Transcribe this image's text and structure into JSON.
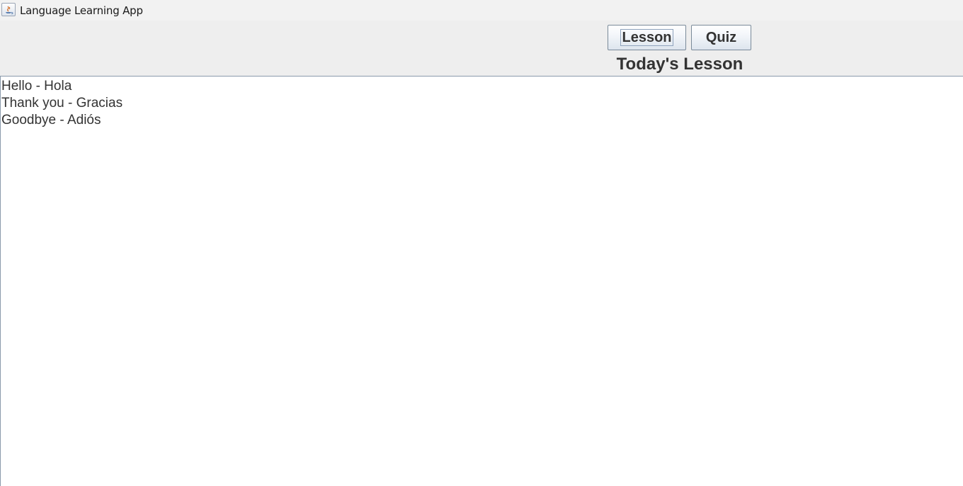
{
  "window": {
    "title": "Language Learning App",
    "icon": "java-icon"
  },
  "toolbar": {
    "lesson_label": "Lesson",
    "quiz_label": "Quiz",
    "selected": "Lesson"
  },
  "lesson": {
    "heading": "Today's Lesson",
    "lines": [
      "Hello - Hola",
      "Thank you - Gracias",
      "Goodbye - Adiós"
    ]
  }
}
